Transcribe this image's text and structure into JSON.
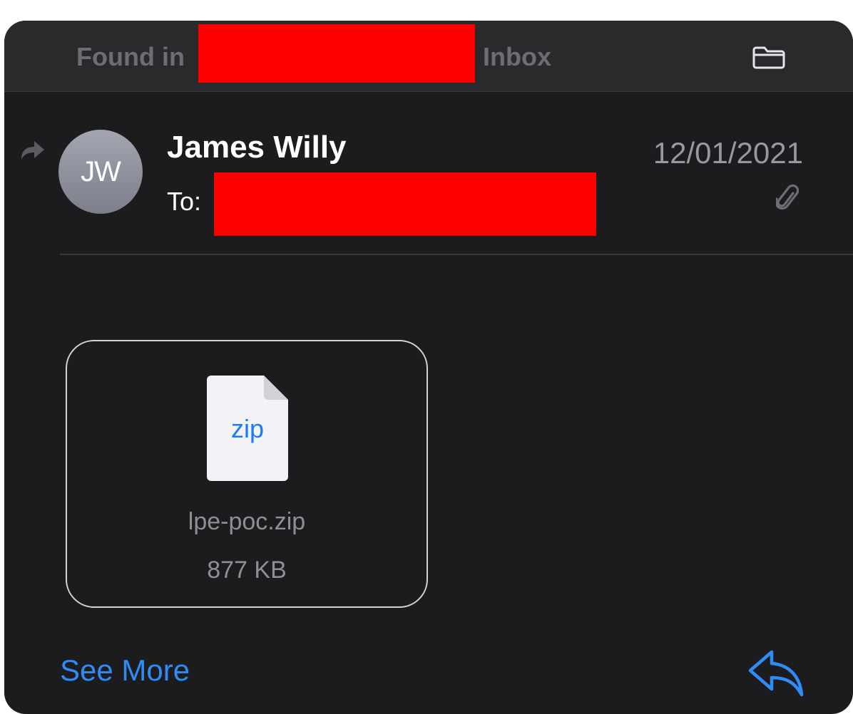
{
  "header": {
    "found_in_label": "Found in",
    "mailbox_name": "Inbox",
    "folder_icon": "folder-icon"
  },
  "message": {
    "forwarded_icon": "forward-arrow-icon",
    "avatar_initials": "JW",
    "sender_name": "James Willy",
    "to_label": "To:",
    "date": "12/01/2021",
    "attachment_indicator_icon": "paperclip-icon"
  },
  "attachment": {
    "file_extension": "zip",
    "file_name": "lpe-poc.zip",
    "file_size": "877 KB"
  },
  "footer": {
    "see_more_label": "See More",
    "reply_icon": "reply-icon"
  },
  "colors": {
    "background": "#1c1c1e",
    "header_background": "#2a2a2d",
    "accent_blue": "#2f8cf5",
    "redaction": "#ff0000",
    "secondary_text": "#98989f"
  }
}
